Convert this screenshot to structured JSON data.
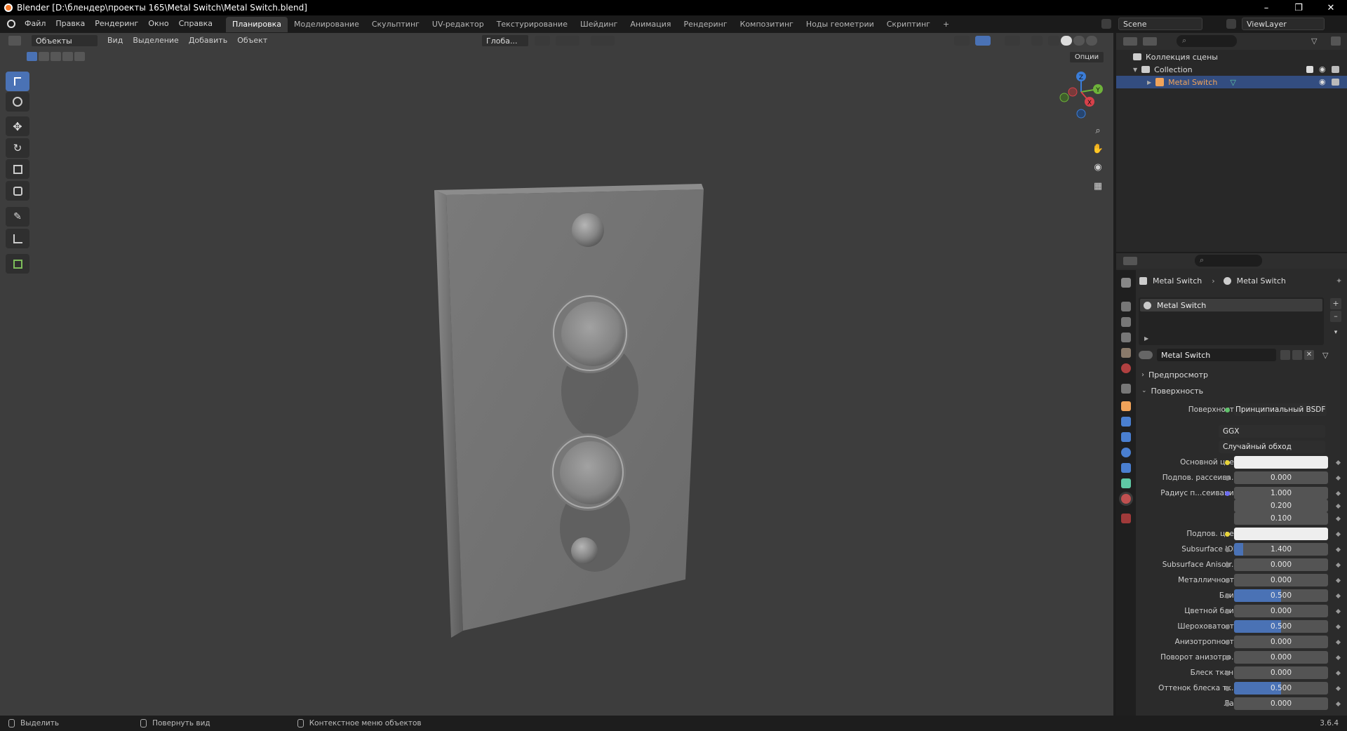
{
  "window": {
    "title": "Blender [D:\\блендер\\проекты 165\\Metal Switch\\Metal Switch.blend]",
    "minimize": "–",
    "restore": "❐",
    "close": "✕"
  },
  "menu": [
    "Файл",
    "Правка",
    "Рендеринг",
    "Окно",
    "Справка"
  ],
  "workspaces": [
    "Планировка",
    "Моделирование",
    "Скульптинг",
    "UV-редактор",
    "Текстурирование",
    "Шейдинг",
    "Анимация",
    "Рендеринг",
    "Композитинг",
    "Ноды геометрии",
    "Скриптинг",
    "+"
  ],
  "active_workspace": "Планировка",
  "scene": {
    "name": "Scene",
    "view_layer": "ViewLayer"
  },
  "viewport_header": {
    "mode": "Объекты",
    "menus": [
      "Вид",
      "Выделение",
      "Добавить",
      "Объект"
    ],
    "orientation": "Глоба...",
    "options": "Опции"
  },
  "toolbar_tools": [
    "select-box-icon",
    "cursor-icon",
    "move-icon",
    "rotate-icon",
    "scale-icon",
    "transform-icon",
    "annotate-icon",
    "measure-icon",
    "add-cube-icon"
  ],
  "gizmo": {
    "z": "Z",
    "y": "Y",
    "x": "X"
  },
  "outliner": {
    "scene_collection": "Коллекция сцены",
    "collection": "Collection",
    "object": "Metal Switch"
  },
  "properties": {
    "breadcrumb_object": "Metal Switch",
    "breadcrumb_material": "Metal Switch",
    "material_slot": "Metal Switch",
    "material_name": "Metal Switch",
    "panel_preview": "Предпросмотр",
    "panel_surface": "Поверхность",
    "surface_label": "Поверхность",
    "surface_value": "Принципиальный BSDF",
    "distribution": "GGX",
    "subsurface_method": "Случайный обход",
    "rows": [
      {
        "label": "Основной цвет",
        "type": "color",
        "value": "",
        "color": "#eeeeee",
        "dot": "#e8d43a"
      },
      {
        "label": "Подпов. рассеива...",
        "type": "num",
        "value": "0.000",
        "fill": 0
      },
      {
        "label": "Радиус п...сеивания",
        "type": "num",
        "value": "1.000",
        "fill": 0,
        "dot": "#6d6df0"
      },
      {
        "label": "",
        "type": "num",
        "value": "0.200",
        "fill": 0
      },
      {
        "label": "",
        "type": "num",
        "value": "0.100",
        "fill": 0
      },
      {
        "label": "Подпов. цвет",
        "type": "color",
        "value": "",
        "color": "#eeeeee",
        "dot": "#e8d43a"
      },
      {
        "label": "Subsurface IOR",
        "type": "num",
        "value": "1.400",
        "fill": 0.1
      },
      {
        "label": "Subsurface Anisotr...",
        "type": "num",
        "value": "0.000",
        "fill": 0
      },
      {
        "label": "Металличность",
        "type": "num",
        "value": "0.000",
        "fill": 0
      },
      {
        "label": "Блик",
        "type": "num",
        "value": "0.500",
        "fill": 0.5
      },
      {
        "label": "Цветной блик",
        "type": "num",
        "value": "0.000",
        "fill": 0
      },
      {
        "label": "Шероховатость",
        "type": "num",
        "value": "0.500",
        "fill": 0.5
      },
      {
        "label": "Анизотропность",
        "type": "num",
        "value": "0.000",
        "fill": 0
      },
      {
        "label": "Поворот анизотро...",
        "type": "num",
        "value": "0.000",
        "fill": 0
      },
      {
        "label": "Блеск ткани",
        "type": "num",
        "value": "0.000",
        "fill": 0
      },
      {
        "label": "Оттенок блеска тк...",
        "type": "num",
        "value": "0.500",
        "fill": 0.5
      },
      {
        "label": "Лак",
        "type": "num",
        "value": "0.000",
        "fill": 0
      }
    ]
  },
  "status": {
    "select": "Выделить",
    "rotate": "Повернуть вид",
    "context_menu": "Контекстное меню объектов",
    "version": "3.6.4"
  },
  "colors": {
    "accent": "#4a72b5",
    "viewport_bg": "#3d3d3d",
    "selected_row": "#334d80",
    "object_orange": "#f0a35a"
  }
}
